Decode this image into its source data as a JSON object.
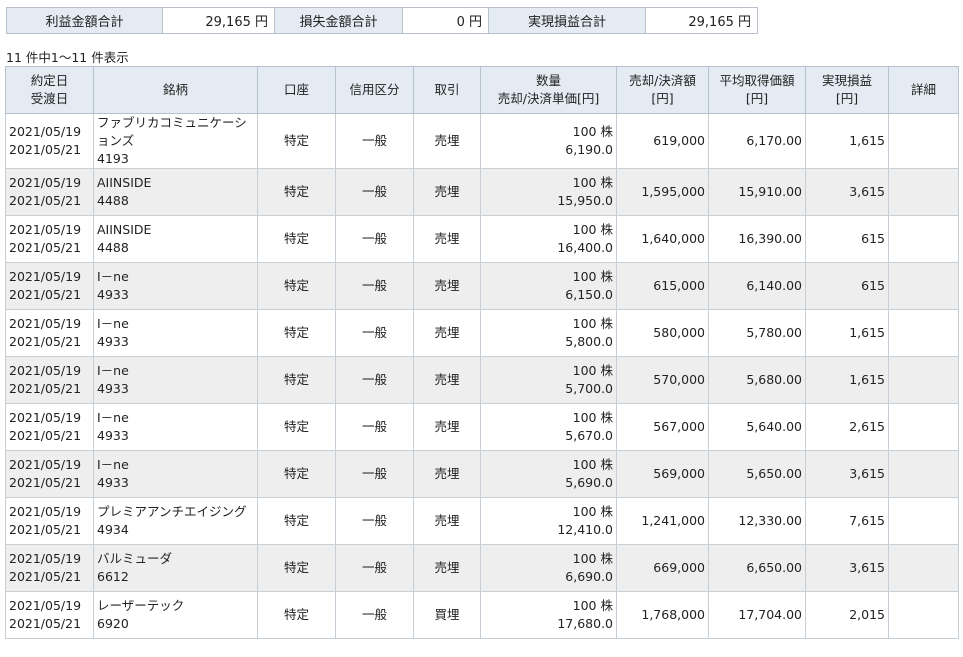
{
  "summary": {
    "profit_label": "利益金額合計",
    "profit_value": "29,165 円",
    "loss_label": "損失金額合計",
    "loss_value": "0 円",
    "realized_label": "実現損益合計",
    "realized_value": "29,165 円"
  },
  "count_text": "11 件中1～11 件表示",
  "headers": {
    "date_line1": "約定日",
    "date_line2": "受渡日",
    "stock": "銘柄",
    "account": "口座",
    "credit": "信用区分",
    "trade": "取引",
    "qty_line1": "数量",
    "qty_line2": "売却/決済単価[円]",
    "amount_line1": "売却/決済額",
    "amount_line2": "[円]",
    "avg_line1": "平均取得価額",
    "avg_line2": "[円]",
    "pl_line1": "実現損益",
    "pl_line2": "[円]",
    "detail": "詳細"
  },
  "rows": [
    {
      "trade_date": "2021/05/19",
      "settle_date": "2021/05/21",
      "name": "ファブリカコミュニケーションズ",
      "code": "4193",
      "account": "特定",
      "credit": "一般",
      "trade": "売埋",
      "qty": "100 株",
      "price": "6,190.0",
      "amount": "619,000",
      "avg": "6,170.00",
      "pl": "1,615"
    },
    {
      "trade_date": "2021/05/19",
      "settle_date": "2021/05/21",
      "name": "AIINSIDE",
      "code": "4488",
      "account": "特定",
      "credit": "一般",
      "trade": "売埋",
      "qty": "100 株",
      "price": "15,950.0",
      "amount": "1,595,000",
      "avg": "15,910.00",
      "pl": "3,615"
    },
    {
      "trade_date": "2021/05/19",
      "settle_date": "2021/05/21",
      "name": "AIINSIDE",
      "code": "4488",
      "account": "特定",
      "credit": "一般",
      "trade": "売埋",
      "qty": "100 株",
      "price": "16,400.0",
      "amount": "1,640,000",
      "avg": "16,390.00",
      "pl": "615"
    },
    {
      "trade_date": "2021/05/19",
      "settle_date": "2021/05/21",
      "name": "I－ne",
      "code": "4933",
      "account": "特定",
      "credit": "一般",
      "trade": "売埋",
      "qty": "100 株",
      "price": "6,150.0",
      "amount": "615,000",
      "avg": "6,140.00",
      "pl": "615"
    },
    {
      "trade_date": "2021/05/19",
      "settle_date": "2021/05/21",
      "name": "I－ne",
      "code": "4933",
      "account": "特定",
      "credit": "一般",
      "trade": "売埋",
      "qty": "100 株",
      "price": "5,800.0",
      "amount": "580,000",
      "avg": "5,780.00",
      "pl": "1,615"
    },
    {
      "trade_date": "2021/05/19",
      "settle_date": "2021/05/21",
      "name": "I－ne",
      "code": "4933",
      "account": "特定",
      "credit": "一般",
      "trade": "売埋",
      "qty": "100 株",
      "price": "5,700.0",
      "amount": "570,000",
      "avg": "5,680.00",
      "pl": "1,615"
    },
    {
      "trade_date": "2021/05/19",
      "settle_date": "2021/05/21",
      "name": "I－ne",
      "code": "4933",
      "account": "特定",
      "credit": "一般",
      "trade": "売埋",
      "qty": "100 株",
      "price": "5,670.0",
      "amount": "567,000",
      "avg": "5,640.00",
      "pl": "2,615"
    },
    {
      "trade_date": "2021/05/19",
      "settle_date": "2021/05/21",
      "name": "I－ne",
      "code": "4933",
      "account": "特定",
      "credit": "一般",
      "trade": "売埋",
      "qty": "100 株",
      "price": "5,690.0",
      "amount": "569,000",
      "avg": "5,650.00",
      "pl": "3,615"
    },
    {
      "trade_date": "2021/05/19",
      "settle_date": "2021/05/21",
      "name": "プレミアアンチエイジング",
      "code": "4934",
      "account": "特定",
      "credit": "一般",
      "trade": "売埋",
      "qty": "100 株",
      "price": "12,410.0",
      "amount": "1,241,000",
      "avg": "12,330.00",
      "pl": "7,615"
    },
    {
      "trade_date": "2021/05/19",
      "settle_date": "2021/05/21",
      "name": "バルミューダ",
      "code": "6612",
      "account": "特定",
      "credit": "一般",
      "trade": "売埋",
      "qty": "100 株",
      "price": "6,690.0",
      "amount": "669,000",
      "avg": "6,650.00",
      "pl": "3,615"
    },
    {
      "trade_date": "2021/05/19",
      "settle_date": "2021/05/21",
      "name": "レーザーテック",
      "code": "6920",
      "account": "特定",
      "credit": "一般",
      "trade": "買埋",
      "qty": "100 株",
      "price": "17,680.0",
      "amount": "1,768,000",
      "avg": "17,704.00",
      "pl": "2,015"
    }
  ]
}
